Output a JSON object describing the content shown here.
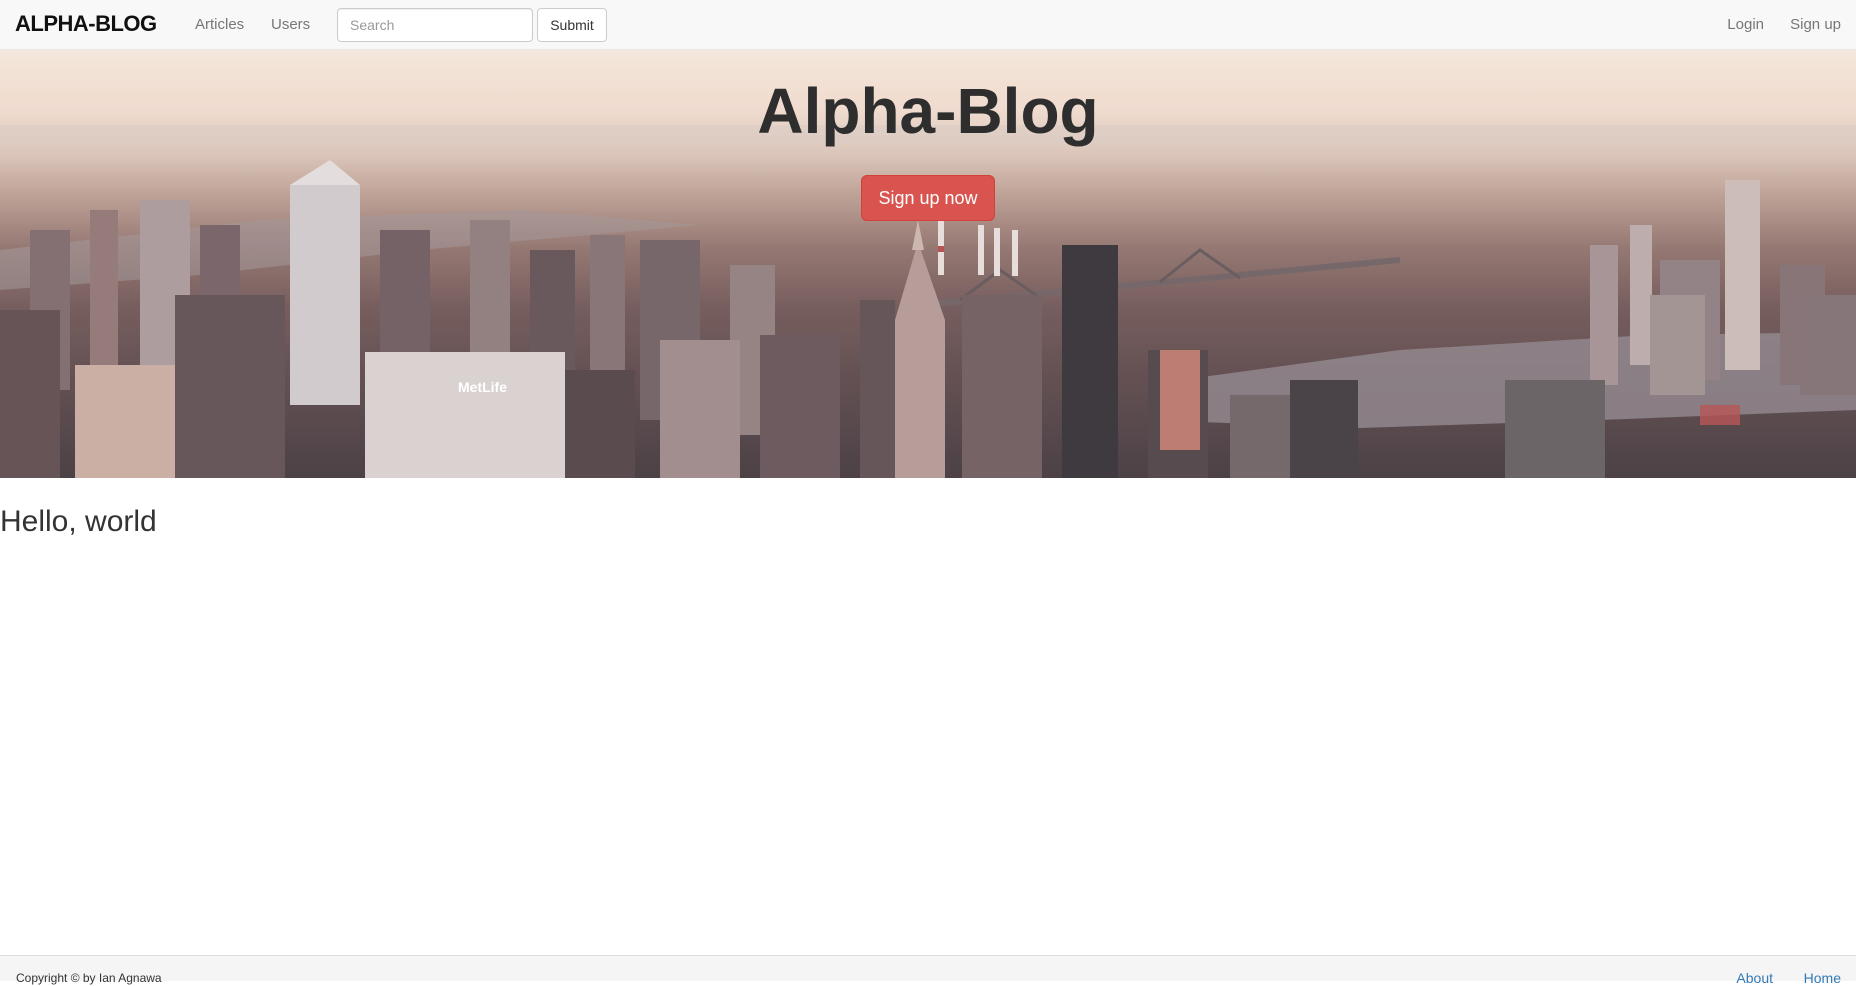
{
  "navbar": {
    "brand": "ALPHA-BLOG",
    "links": [
      "Articles",
      "Users"
    ],
    "search": {
      "placeholder": "Search",
      "value": ""
    },
    "submit_label": "Submit",
    "right_links": [
      "Login",
      "Sign up"
    ]
  },
  "hero": {
    "title": "Alpha-Blog",
    "cta_label": "Sign up now",
    "cta_color": "#d9534f"
  },
  "main": {
    "heading": "Hello, world"
  },
  "footer": {
    "copyright": "Copyright © by Ian Agnawa",
    "links": [
      "About",
      "Home"
    ],
    "link_color": "#337ab7"
  }
}
